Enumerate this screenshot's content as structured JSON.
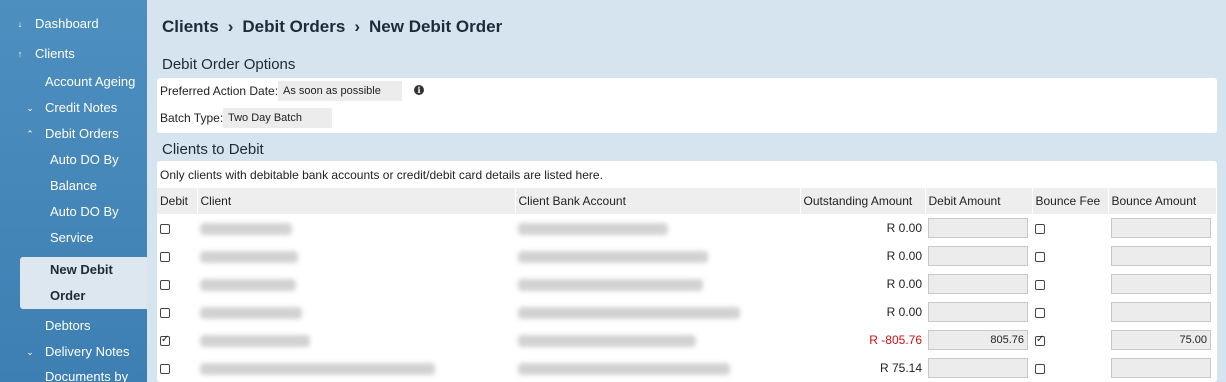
{
  "sidebar": {
    "items": [
      {
        "label": "Dashboard",
        "arrow": "🡣"
      },
      {
        "label": "Clients",
        "arrow": "🡡"
      },
      {
        "label": "Account Ageing"
      },
      {
        "label": "Credit Notes",
        "arrow": "⌄"
      },
      {
        "label": "Debit Orders",
        "arrow": "⌃"
      },
      {
        "label": "Auto DO By"
      },
      {
        "label": "Balance"
      },
      {
        "label": "Auto DO By"
      },
      {
        "label": "Service"
      },
      {
        "label": "Debtors"
      },
      {
        "label": "Delivery Notes",
        "arrow": "⌄"
      },
      {
        "label": "Documents by"
      }
    ],
    "active": {
      "line1": "New Debit",
      "line2": "Order"
    }
  },
  "breadcrumb": {
    "level1": "Clients",
    "level2": "Debit Orders",
    "level3": "New Debit Order",
    "separator": "›"
  },
  "options": {
    "title": "Debit Order Options",
    "preferred_label": "Preferred Action Date:",
    "preferred_value": "As soon as possible",
    "batch_label": "Batch Type:",
    "batch_value": "Two Day Batch"
  },
  "clients": {
    "title": "Clients to Debit",
    "note": "Only clients with debitable bank accounts or credit/debit card details are listed here.",
    "columns": {
      "debit": "Debit",
      "client": "Client",
      "bank": "Client Bank Account",
      "outstanding": "Outstanding Amount",
      "debit_amount": "Debit Amount",
      "bounce_fee": "Bounce Fee",
      "bounce_amount": "Bounce Amount"
    },
    "rows": [
      {
        "outstanding": "R 0.00",
        "debit_amount": "",
        "bounce_amount": ""
      },
      {
        "outstanding": "R 0.00",
        "debit_amount": "",
        "bounce_amount": ""
      },
      {
        "outstanding": "R 0.00",
        "debit_amount": "",
        "bounce_amount": ""
      },
      {
        "outstanding": "R 0.00",
        "debit_amount": "",
        "bounce_amount": ""
      },
      {
        "outstanding": "R -805.76",
        "debit_amount": "805.76",
        "bounce_amount": "75.00"
      },
      {
        "outstanding": "R 75.14",
        "debit_amount": "",
        "bounce_amount": ""
      }
    ]
  },
  "colors": {
    "sidebar": "#4d8fbf",
    "content_bg": "#d6e4ef",
    "negative": "#cc1111"
  }
}
